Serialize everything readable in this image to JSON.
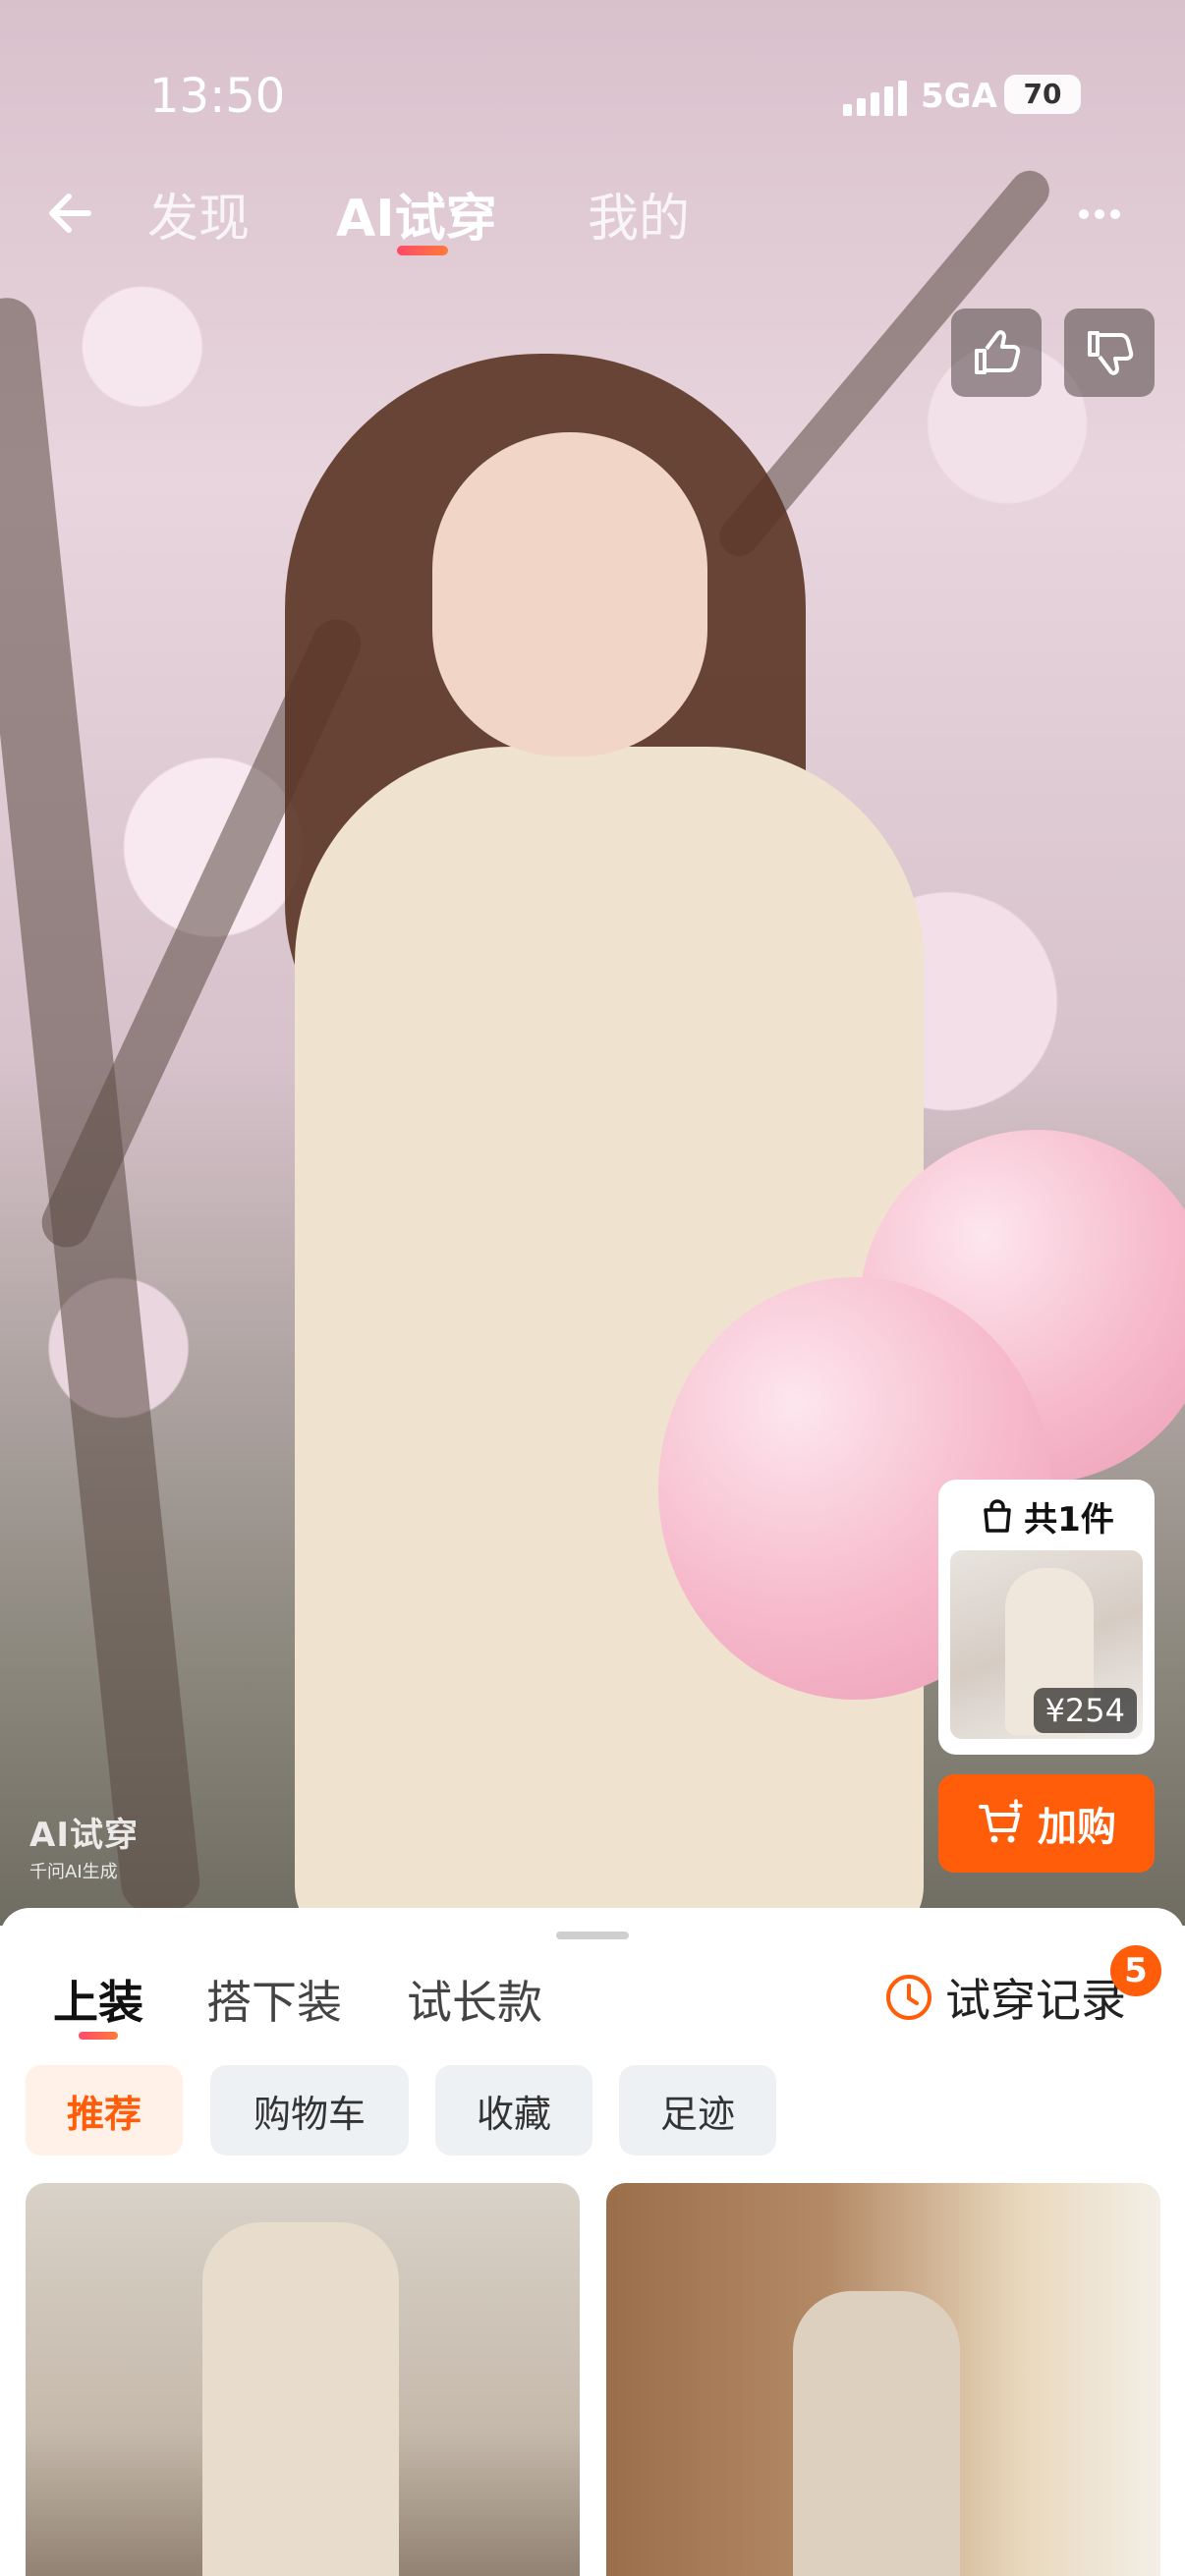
{
  "status_bar": {
    "time": "13:50",
    "network": "5GA",
    "battery": "70"
  },
  "top_nav": {
    "back_icon": "arrow-left-icon",
    "tabs": [
      {
        "label": "发现",
        "active": false
      },
      {
        "label": "AI试穿",
        "active": true
      },
      {
        "label": "我的",
        "active": false
      }
    ],
    "more_icon": "more-dots-icon"
  },
  "rating": {
    "like_icon": "thumbs-up-icon",
    "dislike_icon": "thumbs-down-icon"
  },
  "watermark": {
    "title": "AI试穿",
    "subtitle": "千问AI生成"
  },
  "outfit_card": {
    "count_label": "共1件",
    "price": "¥254",
    "bag_icon": "shopping-bag-icon"
  },
  "add_to_cart": {
    "label": "加购",
    "icon": "cart-plus-icon"
  },
  "sheet": {
    "categories": [
      {
        "label": "上装",
        "active": true
      },
      {
        "label": "搭下装",
        "active": false
      },
      {
        "label": "试长款",
        "active": false
      }
    ],
    "history": {
      "label": "试穿记录",
      "badge": "5",
      "icon": "clock-icon"
    },
    "filters": [
      {
        "label": "推荐",
        "active": true
      },
      {
        "label": "购物车",
        "active": false
      },
      {
        "label": "收藏",
        "active": false
      },
      {
        "label": "足迹",
        "active": false
      }
    ]
  },
  "colors": {
    "accent": "#ff5d0a",
    "indicator_start": "#ff4a6a",
    "indicator_end": "#ff7a3a"
  }
}
